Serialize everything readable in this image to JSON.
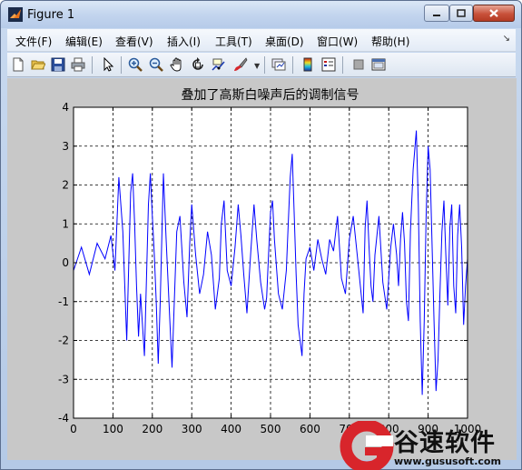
{
  "window": {
    "title": "Figure 1"
  },
  "menu": {
    "items": [
      "文件(F)",
      "编辑(E)",
      "查看(V)",
      "插入(I)",
      "工具(T)",
      "桌面(D)",
      "窗口(W)",
      "帮助(H)"
    ]
  },
  "toolbar": {
    "icons": [
      "new-figure-icon",
      "open-file-icon",
      "save-icon",
      "print-icon",
      "select-arrow-icon",
      "zoom-in-icon",
      "zoom-out-icon",
      "pan-hand-icon",
      "rotate-3d-icon",
      "data-cursor-icon",
      "brush-icon",
      "link-plot-icon",
      "colorbar-icon",
      "legend-icon",
      "hide-plot-tools-icon",
      "show-plot-tools-icon"
    ]
  },
  "watermark": {
    "text": "谷速软件",
    "url": "www.gususoft.com"
  },
  "chart_data": {
    "type": "line",
    "title": "叠加了高斯白噪声后的调制信号",
    "xlabel": "",
    "ylabel": "",
    "xlim": [
      0,
      1000
    ],
    "ylim": [
      -4,
      4
    ],
    "xticks": [
      0,
      100,
      200,
      300,
      400,
      500,
      600,
      700,
      800,
      900,
      1000
    ],
    "xtick_labels": [
      "0",
      "100",
      "200",
      "300",
      "400",
      "500",
      "600",
      "700",
      "800",
      "900",
      "1000"
    ],
    "yticks": [
      -4,
      -3,
      -2,
      -1,
      0,
      1,
      2,
      3,
      4
    ],
    "ytick_labels": [
      "-4",
      "-3",
      "-2",
      "-1",
      "0",
      "1",
      "2",
      "3",
      "4"
    ],
    "grid": true,
    "grid_style": "dashed",
    "line_color": "#0000ff",
    "series": [
      {
        "x": [
          0,
          20,
          40,
          60,
          80,
          95,
          105,
          115,
          125,
          135,
          145,
          150,
          155,
          160,
          165,
          170,
          180,
          190,
          195,
          200,
          205,
          210,
          215,
          220,
          228,
          235,
          245,
          250,
          255,
          262,
          270,
          280,
          288,
          295,
          300,
          310,
          320,
          330,
          340,
          350,
          360,
          370,
          375,
          382,
          390,
          400,
          410,
          418,
          425,
          432,
          440,
          450,
          458,
          465,
          475,
          485,
          490,
          495,
          500,
          505,
          510,
          520,
          530,
          540,
          545,
          550,
          555,
          560,
          565,
          570,
          580,
          585,
          590,
          600,
          610,
          620,
          630,
          640,
          650,
          660,
          670,
          680,
          690,
          700,
          710,
          720,
          730,
          735,
          740,
          745,
          750,
          755,
          760,
          765,
          775,
          785,
          795,
          805,
          812,
          820,
          825,
          830,
          835,
          840,
          845,
          850,
          855,
          862,
          870,
          875,
          880,
          885,
          890,
          895,
          900,
          905,
          910,
          915,
          920,
          925,
          930,
          935,
          940,
          945,
          950,
          955,
          960,
          965,
          970,
          975,
          980,
          985,
          990,
          995,
          1000
        ],
        "y": [
          -0.2,
          0.4,
          -0.3,
          0.5,
          0.1,
          0.7,
          -0.2,
          2.2,
          0.8,
          -2.0,
          1.8,
          2.3,
          1.0,
          -0.6,
          -1.9,
          -0.8,
          -2.4,
          1.5,
          2.3,
          1.2,
          0.2,
          -1.0,
          -2.6,
          -1.0,
          2.3,
          0.6,
          -1.6,
          -2.7,
          -1.2,
          0.8,
          1.2,
          -0.5,
          -1.4,
          0.5,
          1.5,
          0.2,
          -0.8,
          -0.3,
          0.8,
          0.2,
          -1.2,
          -0.4,
          1.0,
          1.6,
          -0.2,
          -0.6,
          0.4,
          1.5,
          0.7,
          -0.3,
          -1.3,
          0.3,
          1.5,
          0.6,
          -0.5,
          -1.2,
          -0.9,
          0.2,
          1.3,
          1.6,
          0.6,
          -0.8,
          -1.2,
          -0.2,
          1.0,
          2.2,
          2.8,
          1.3,
          -0.3,
          -1.6,
          -2.4,
          -0.8,
          0.1,
          0.4,
          -0.2,
          0.6,
          0.1,
          -0.3,
          0.6,
          0.3,
          1.2,
          -0.4,
          -0.8,
          0.6,
          1.2,
          0.2,
          -0.8,
          -1.3,
          0.9,
          1.6,
          0.4,
          -0.6,
          -1.0,
          0.2,
          1.2,
          -0.5,
          -1.2,
          0.4,
          1.0,
          0.2,
          -0.6,
          0.6,
          1.3,
          0.5,
          -1.0,
          -1.5,
          0.8,
          2.4,
          3.4,
          1.5,
          -1.5,
          -3.4,
          -1.5,
          1.2,
          3.0,
          2.4,
          0.5,
          -1.5,
          -3.3,
          -2.5,
          -0.8,
          0.8,
          1.6,
          0.2,
          -1.1,
          0.9,
          1.5,
          -0.6,
          -1.3,
          0.7,
          1.5,
          0.4,
          -1.6,
          -0.6,
          0.1
        ]
      }
    ]
  }
}
